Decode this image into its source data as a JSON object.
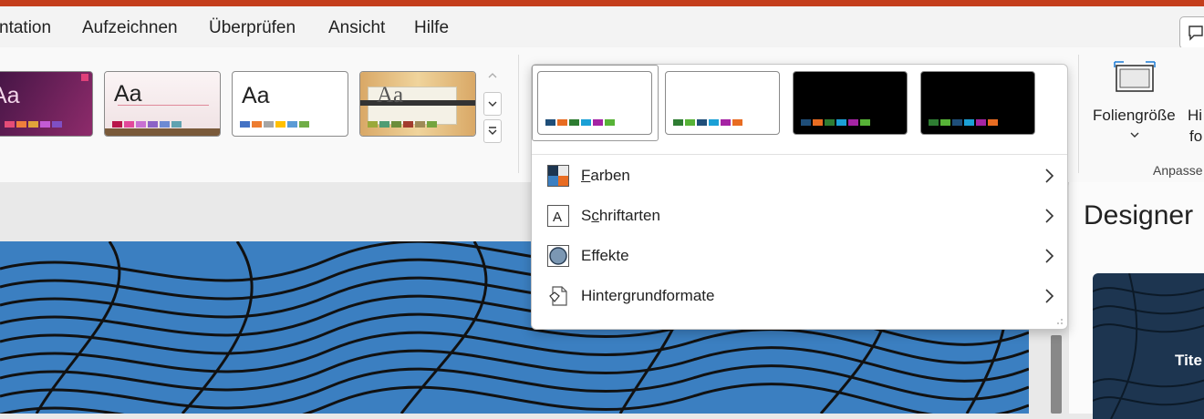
{
  "menu": {
    "items": [
      "ntation",
      "Aufzeichnen",
      "Überprüfen",
      "Ansicht",
      "Hilfe"
    ]
  },
  "themes": [
    {
      "name": "theme-purple",
      "aa": "Aa",
      "bg": "#6a2a5e",
      "colors": [
        "#e44c77",
        "#f07f3c",
        "#e0a43a",
        "#c35bd4",
        "#7f4fc4"
      ]
    },
    {
      "name": "theme-wood-pink",
      "aa": "Aa",
      "bg": "#f4e4e7",
      "colors": [
        "#b8164a",
        "#e2489a",
        "#c870d2",
        "#8c62c6",
        "#6d8ad3",
        "#5fa2b0"
      ]
    },
    {
      "name": "theme-office",
      "aa": "Aa",
      "bg": "#ffffff",
      "colors": [
        "#4472c4",
        "#ed7d31",
        "#a5a5a5",
        "#ffc000",
        "#5b9bd5",
        "#70ad47"
      ]
    },
    {
      "name": "theme-wood-frame",
      "aa": "Aa",
      "bg": "#e8c48a",
      "colors": [
        "#9aa93a",
        "#4f9c73",
        "#6b8d3a",
        "#a23c2d",
        "#9e8a57",
        "#74a43f"
      ]
    }
  ],
  "variants": [
    {
      "bg": "#ffffff",
      "colors": [
        "#1f4e79",
        "#e86c22",
        "#2e7d32",
        "#1ba0d6",
        "#a524a4",
        "#57b337"
      ]
    },
    {
      "bg": "#ffffff",
      "colors": [
        "#2e7d32",
        "#57b337",
        "#1f4e79",
        "#1ba0d6",
        "#a524a4",
        "#e86c22"
      ]
    },
    {
      "bg": "#000000",
      "colors": [
        "#1f4e79",
        "#e86c22",
        "#2e7d32",
        "#1ba0d6",
        "#a524a4",
        "#57b337"
      ]
    },
    {
      "bg": "#000000",
      "colors": [
        "#2e7d32",
        "#57b337",
        "#1f4e79",
        "#1ba0d6",
        "#a524a4",
        "#e86c22"
      ]
    }
  ],
  "dropdown": {
    "items": [
      {
        "label": "Farben",
        "icon": "colors-icon",
        "access_key": "F"
      },
      {
        "label": "Schriftarten",
        "icon": "fonts-icon",
        "access_key": "c"
      },
      {
        "label": "Effekte",
        "icon": "effects-icon",
        "access_key": ""
      },
      {
        "label": "Hintergrundformate",
        "icon": "background-styles-icon",
        "access_key": ""
      }
    ]
  },
  "customize": {
    "slide_size_label": "Foliengröße",
    "background_label_line1": "Hi",
    "background_label_line2": "fo",
    "group_label": "Anpasse"
  },
  "designer": {
    "title": "Designer",
    "thumb_title": "Tite"
  },
  "colors": {
    "accent": "#c43e1c",
    "slide_blue": "#3b7fc1"
  }
}
